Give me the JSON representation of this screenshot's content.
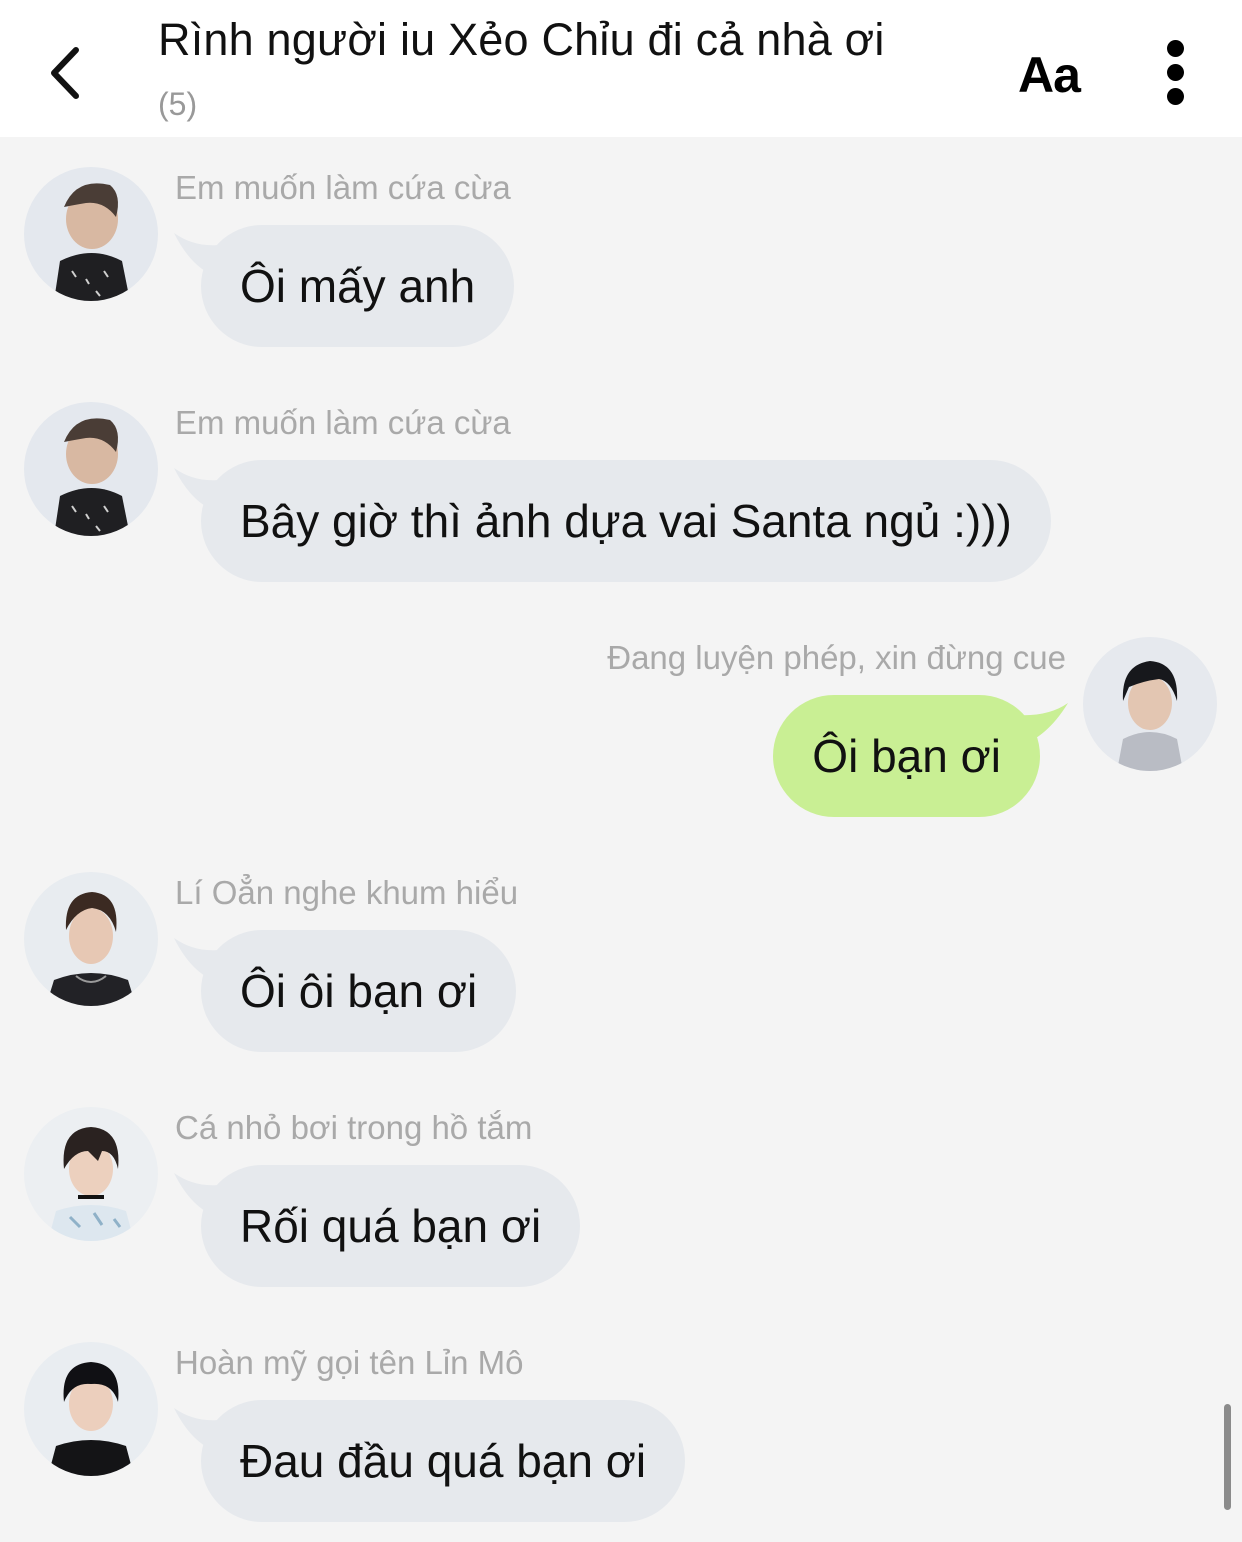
{
  "header": {
    "title": "Rình người iu Xẻo Chỉu đi cả nhà ơi",
    "member_count": "(5)",
    "font_button_label": "Aa"
  },
  "colors": {
    "header_bg": "#ffffff",
    "chat_bg": "#f4f4f4",
    "incoming_bubble": "#e6e9ed",
    "outgoing_bubble": "#c9ef94",
    "sender_text": "#a9a9a9"
  },
  "messages": [
    {
      "side": "left",
      "sender": "Em muốn làm cứa cừa",
      "text": "Ôi mấy anh",
      "avatar": "user-avatar"
    },
    {
      "side": "left",
      "sender": "Em muốn làm cứa cừa",
      "text": "Bây giờ thì ảnh dựa vai Santa ngủ :)))",
      "avatar": "user-avatar"
    },
    {
      "side": "right",
      "sender": "Đang luyện phép, xin đừng cue",
      "text": "Ôi bạn ơi",
      "avatar": "user-avatar"
    },
    {
      "side": "left",
      "sender": "Lí Oẳn nghe khum hiểu",
      "text": "Ôi ôi bạn ơi",
      "avatar": "user-avatar"
    },
    {
      "side": "left",
      "sender": "Cá nhỏ bơi trong hồ tắm",
      "text": "Rối quá bạn ơi",
      "avatar": "user-avatar"
    },
    {
      "side": "left",
      "sender": "Hoàn mỹ gọi tên Lỉn Mô",
      "text": "Đau đầu quá bạn ơi",
      "avatar": "user-avatar"
    }
  ]
}
